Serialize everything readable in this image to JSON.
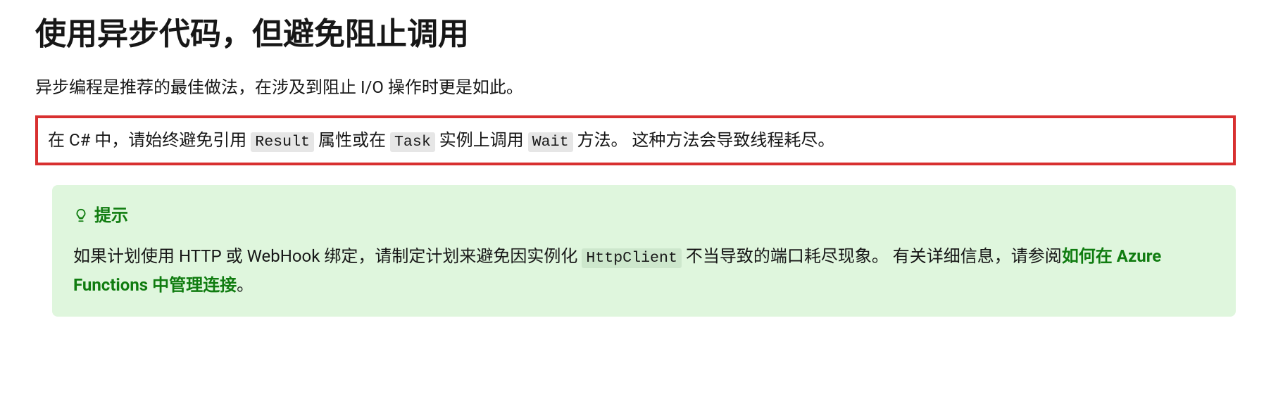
{
  "heading": "使用异步代码，但避免阻止调用",
  "intro": "异步编程是推荐的最佳做法，在涉及到阻止 I/O 操作时更是如此。",
  "highlighted": {
    "prefix": "在 C# 中，请始终避免引用 ",
    "code1": "Result",
    "mid1": " 属性或在 ",
    "code2": "Task",
    "mid2": " 实例上调用 ",
    "code3": "Wait",
    "suffix": " 方法。 这种方法会导致线程耗尽。"
  },
  "alert": {
    "title": "提示",
    "body_prefix": "如果计划使用 HTTP 或 WebHook 绑定，请制定计划来避免因实例化 ",
    "code": "HttpClient",
    "body_mid": " 不当导致的端口耗尽现象。 有关详细信息，请参阅",
    "link_text": "如何在 Azure Functions 中管理连接",
    "body_suffix": "。"
  }
}
